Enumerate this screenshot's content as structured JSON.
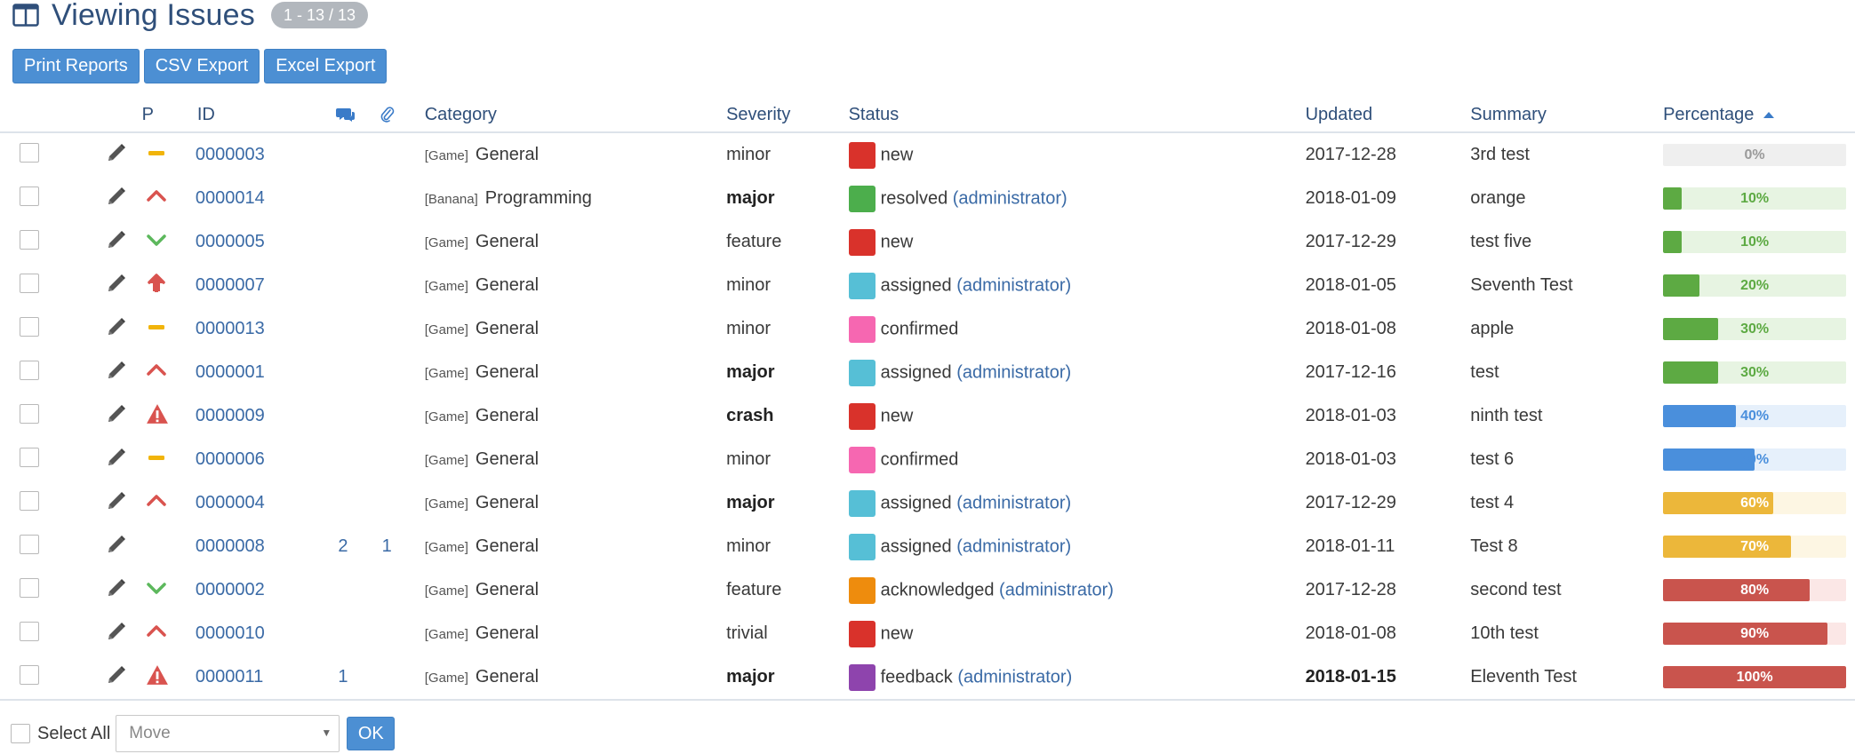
{
  "header": {
    "title": "Viewing Issues",
    "count": "1 - 13 / 13",
    "icon": "columns-icon"
  },
  "toolbar": {
    "print_label": "Print Reports",
    "csv_label": "CSV Export",
    "excel_label": "Excel Export"
  },
  "columns": {
    "p": "P",
    "id": "ID",
    "category": "Category",
    "severity": "Severity",
    "status": "Status",
    "updated": "Updated",
    "summary": "Summary",
    "percentage": "Percentage",
    "notes_icon": "comments-icon",
    "attachments_icon": "paperclip-icon",
    "sort_icon": "sort-ascending-icon"
  },
  "colors": {
    "accent": "#4c8fd3",
    "status_new": "#d9322b",
    "status_resolved": "#4cae4c",
    "status_assigned": "#56bfd6",
    "status_confirmed": "#f667b1",
    "status_acknowledged": "#ee8c0d",
    "status_feedback": "#8e44ad"
  },
  "issues": [
    {
      "priority": "normal",
      "id": "0000003",
      "notes": "",
      "attachments": "",
      "project": "[Game]",
      "category": "General",
      "severity": "minor",
      "severity_bold": false,
      "status_color": "#d9322b",
      "status": "new",
      "handler": "",
      "updated": "2017-12-28",
      "updated_bold": false,
      "summary": "3rd test",
      "percent": 0,
      "percent_label": "0%"
    },
    {
      "priority": "high",
      "id": "0000014",
      "notes": "",
      "attachments": "",
      "project": "[Banana]",
      "category": "Programming",
      "severity": "major",
      "severity_bold": true,
      "status_color": "#4cae4c",
      "status": "resolved",
      "handler": "(administrator)",
      "updated": "2018-01-09",
      "updated_bold": false,
      "summary": "orange",
      "percent": 10,
      "percent_label": "10%"
    },
    {
      "priority": "low",
      "id": "0000005",
      "notes": "",
      "attachments": "",
      "project": "[Game]",
      "category": "General",
      "severity": "feature",
      "severity_bold": false,
      "status_color": "#d9322b",
      "status": "new",
      "handler": "",
      "updated": "2017-12-29",
      "updated_bold": false,
      "summary": "test five",
      "percent": 10,
      "percent_label": "10%"
    },
    {
      "priority": "urgent",
      "id": "0000007",
      "notes": "",
      "attachments": "",
      "project": "[Game]",
      "category": "General",
      "severity": "minor",
      "severity_bold": false,
      "status_color": "#56bfd6",
      "status": "assigned",
      "handler": "(administrator)",
      "updated": "2018-01-05",
      "updated_bold": false,
      "summary": "Seventh Test",
      "percent": 20,
      "percent_label": "20%"
    },
    {
      "priority": "normal",
      "id": "0000013",
      "notes": "",
      "attachments": "",
      "project": "[Game]",
      "category": "General",
      "severity": "minor",
      "severity_bold": false,
      "status_color": "#f667b1",
      "status": "confirmed",
      "handler": "",
      "updated": "2018-01-08",
      "updated_bold": false,
      "summary": "apple",
      "percent": 30,
      "percent_label": "30%"
    },
    {
      "priority": "high",
      "id": "0000001",
      "notes": "",
      "attachments": "",
      "project": "[Game]",
      "category": "General",
      "severity": "major",
      "severity_bold": true,
      "status_color": "#56bfd6",
      "status": "assigned",
      "handler": "(administrator)",
      "updated": "2017-12-16",
      "updated_bold": false,
      "summary": "test",
      "percent": 30,
      "percent_label": "30%"
    },
    {
      "priority": "immediate",
      "id": "0000009",
      "notes": "",
      "attachments": "",
      "project": "[Game]",
      "category": "General",
      "severity": "crash",
      "severity_bold": true,
      "status_color": "#d9322b",
      "status": "new",
      "handler": "",
      "updated": "2018-01-03",
      "updated_bold": false,
      "summary": "ninth test",
      "percent": 40,
      "percent_label": "40%"
    },
    {
      "priority": "normal",
      "id": "0000006",
      "notes": "",
      "attachments": "",
      "project": "[Game]",
      "category": "General",
      "severity": "minor",
      "severity_bold": false,
      "status_color": "#f667b1",
      "status": "confirmed",
      "handler": "",
      "updated": "2018-01-03",
      "updated_bold": false,
      "summary": "test 6",
      "percent": 50,
      "percent_label": "50%"
    },
    {
      "priority": "high",
      "id": "0000004",
      "notes": "",
      "attachments": "",
      "project": "[Game]",
      "category": "General",
      "severity": "major",
      "severity_bold": true,
      "status_color": "#56bfd6",
      "status": "assigned",
      "handler": "(administrator)",
      "updated": "2017-12-29",
      "updated_bold": false,
      "summary": "test 4",
      "percent": 60,
      "percent_label": "60%"
    },
    {
      "priority": "none",
      "id": "0000008",
      "notes": "2",
      "attachments": "1",
      "project": "[Game]",
      "category": "General",
      "severity": "minor",
      "severity_bold": false,
      "status_color": "#56bfd6",
      "status": "assigned",
      "handler": "(administrator)",
      "updated": "2018-01-11",
      "updated_bold": false,
      "summary": "Test 8",
      "percent": 70,
      "percent_label": "70%"
    },
    {
      "priority": "low",
      "id": "0000002",
      "notes": "",
      "attachments": "",
      "project": "[Game]",
      "category": "General",
      "severity": "feature",
      "severity_bold": false,
      "status_color": "#ee8c0d",
      "status": "acknowledged",
      "handler": "(administrator)",
      "updated": "2017-12-28",
      "updated_bold": false,
      "summary": "second test",
      "percent": 80,
      "percent_label": "80%"
    },
    {
      "priority": "high",
      "id": "0000010",
      "notes": "",
      "attachments": "",
      "project": "[Game]",
      "category": "General",
      "severity": "trivial",
      "severity_bold": false,
      "status_color": "#d9322b",
      "status": "new",
      "handler": "",
      "updated": "2018-01-08",
      "updated_bold": false,
      "summary": "10th test",
      "percent": 90,
      "percent_label": "90%"
    },
    {
      "priority": "immediate",
      "id": "0000011",
      "notes": "1",
      "attachments": "",
      "project": "[Game]",
      "category": "General",
      "severity": "major",
      "severity_bold": true,
      "status_color": "#8e44ad",
      "status": "feedback",
      "handler": "(administrator)",
      "updated": "2018-01-15",
      "updated_bold": true,
      "summary": "Eleventh Test",
      "percent": 100,
      "percent_label": "100%"
    }
  ],
  "footer": {
    "select_all_label": "Select All",
    "move_placeholder": "Move",
    "ok_label": "OK"
  }
}
